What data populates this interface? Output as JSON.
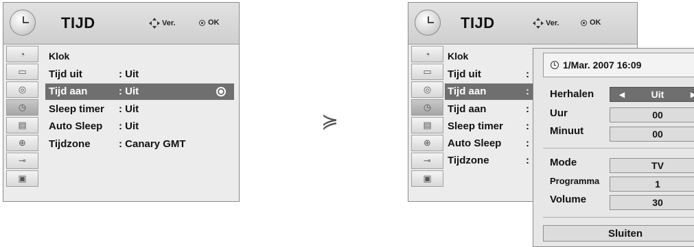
{
  "left_menu": {
    "title": "TIJD",
    "hint_move": "Ver.",
    "hint_ok": "OK",
    "items": [
      {
        "label": "Klok",
        "value": ""
      },
      {
        "label": "Tijd uit",
        "value": ": Uit"
      },
      {
        "label": "Tijd aan",
        "value": ": Uit",
        "selected": true
      },
      {
        "label": "Sleep timer",
        "value": ": Uit"
      },
      {
        "label": "Auto Sleep",
        "value": ": Uit"
      },
      {
        "label": "Tijdzone",
        "value": ": Canary GMT"
      }
    ]
  },
  "transition_arrow": "≽",
  "right_menu": {
    "title": "TIJD",
    "hint_move": "Ver.",
    "hint_ok": "OK",
    "items": [
      {
        "label": "Klok",
        "value": ""
      },
      {
        "label": "Tijd uit",
        "value": ":"
      },
      {
        "label": "Tijd aan",
        "value": ":",
        "selected": true
      },
      {
        "label": "Tijd aan",
        "value": ":"
      },
      {
        "label": "Sleep timer",
        "value": ":"
      },
      {
        "label": "Auto Sleep",
        "value": ":"
      },
      {
        "label": "Tijdzone",
        "value": ":"
      }
    ]
  },
  "popup": {
    "datetime": "1/Mar. 2007 16:09",
    "fields": [
      {
        "label": "Herhalen",
        "value": "Uit",
        "selected": true
      },
      {
        "label": "Uur",
        "value": "00"
      },
      {
        "label": "Minuut",
        "value": "00"
      },
      {
        "label": "Mode",
        "value": "TV"
      },
      {
        "label": "Programma",
        "value": "1"
      },
      {
        "label": "Volume",
        "value": "30"
      }
    ],
    "close_label": "Sluiten"
  },
  "icons": [
    "satellite-dish-icon",
    "monitor-icon",
    "speaker-icon",
    "clock-icon",
    "options-icon",
    "lock-icon",
    "input-plug-icon",
    "photo-icon"
  ],
  "colors": {
    "highlight": "#6f6f6f",
    "panel": "#ececec",
    "header": "#d6d6d6"
  }
}
